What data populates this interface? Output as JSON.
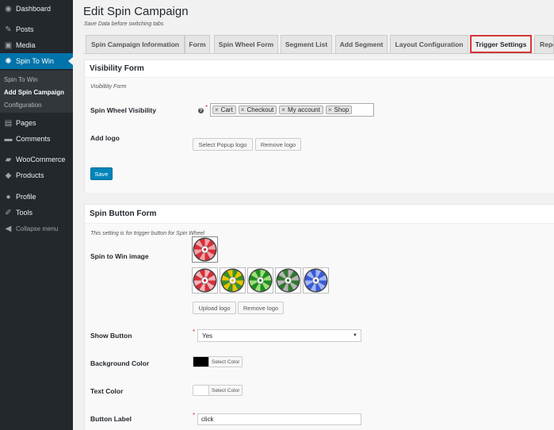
{
  "sidebar": {
    "items": [
      {
        "label": "Dashboard",
        "icon": "dashboard-icon",
        "glyph": "◉"
      },
      {
        "label": "Posts",
        "icon": "pin-icon",
        "glyph": "✎"
      },
      {
        "label": "Media",
        "icon": "media-icon",
        "glyph": "▣"
      },
      {
        "label": "Spin To Win",
        "icon": "spin-wheel-icon",
        "glyph": "✺"
      },
      {
        "label": "Pages",
        "icon": "pages-icon",
        "glyph": "▤"
      },
      {
        "label": "Comments",
        "icon": "comments-icon",
        "glyph": "▬"
      },
      {
        "label": "WooCommerce",
        "icon": "woocommerce-icon",
        "glyph": "▰"
      },
      {
        "label": "Products",
        "icon": "products-icon",
        "glyph": "◆"
      },
      {
        "label": "Profile",
        "icon": "profile-icon",
        "glyph": "●"
      },
      {
        "label": "Tools",
        "icon": "tools-icon",
        "glyph": "✐"
      }
    ],
    "submenu": [
      "Spin To Win",
      "Add Spin Campaign",
      "Configuration"
    ],
    "collapse_label": "Collapse menu",
    "accent": "#0073aa"
  },
  "page": {
    "title": "Edit Spin Campaign",
    "subtitle": "Save Data before switching tabs"
  },
  "tabs": [
    "Spin Campaign Information",
    "Form",
    "Spin Wheel Form",
    "Segment List",
    "Add Segment",
    "Layout Configuration",
    "Trigger Settings",
    "Reports"
  ],
  "active_tab": "Trigger Settings",
  "visibility": {
    "title": "Visibility Form",
    "description": "Visibiltity Form",
    "spin_wheel_label": "Spin Wheel Visibility",
    "tags": [
      "Cart",
      "Checkout",
      "My account",
      "Shop"
    ],
    "tag_remove": "×",
    "add_logo_label": "Add logo",
    "select_logo_btn": "Select Popup logo",
    "remove_logo_btn": "Remove logo",
    "save_btn": "Save"
  },
  "spin_button": {
    "title": "Spin Button Form",
    "description": "This setting is for trigger button for Spin Wheel",
    "image_label": "Spin to Win image",
    "wheel_colors": [
      [
        "#d62f3a",
        "#f2a2a8"
      ],
      [
        "#d62f3a",
        "#f6b3b8"
      ],
      [
        "#e6c500",
        "#3a8f2a"
      ],
      [
        "#1f8f1f",
        "#9be07a"
      ],
      [
        "#2f7a2f",
        "#b5b5b5"
      ],
      [
        "#3b5bd6",
        "#9fb6ff"
      ]
    ],
    "upload_logo_btn": "Upload logo",
    "remove_logo_btn": "Remove logo",
    "show_button_label": "Show Button",
    "show_button_value": "Yes",
    "bg_color_label": "Background Color",
    "bg_color_value": "#000000",
    "select_color_btn": "Select Color",
    "text_color_label": "Text Color",
    "text_color_value": "#ffffff",
    "button_label_label": "Button Label",
    "button_label_value": "click"
  }
}
